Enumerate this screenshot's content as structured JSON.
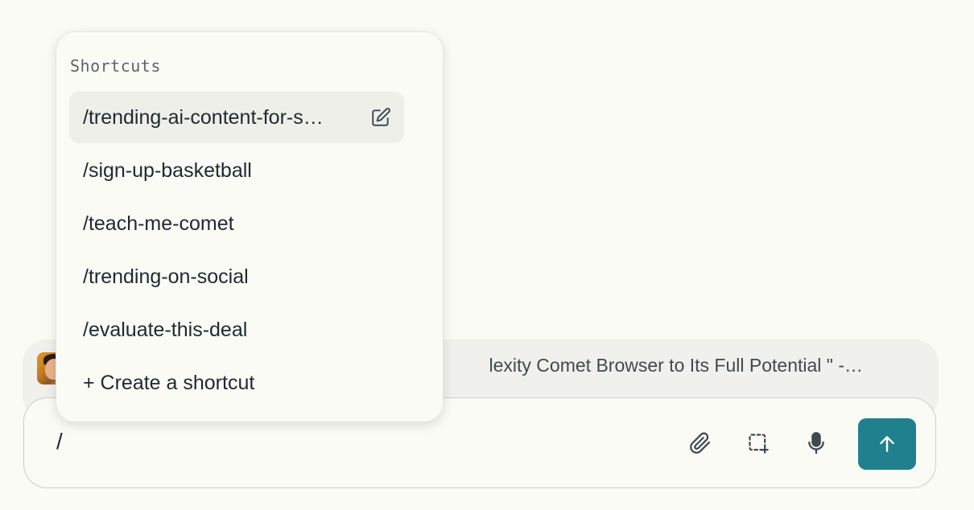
{
  "context": {
    "text": "lexity Comet Browser to Its Full Potential \" -…"
  },
  "shortcuts_menu": {
    "title": "Shortcuts",
    "items": [
      {
        "label": "/trending-ai-content-for-s…",
        "active": true
      },
      {
        "label": "/sign-up-basketball"
      },
      {
        "label": "/teach-me-comet"
      },
      {
        "label": "/trending-on-social"
      },
      {
        "label": "/evaluate-this-deal"
      }
    ],
    "create_label": "+ Create a shortcut"
  },
  "input": {
    "value": "/"
  },
  "toolbar": {
    "icons": [
      "paperclip-icon",
      "screenshot-select-icon",
      "microphone-icon",
      "arrow-up-icon"
    ]
  },
  "colors": {
    "accent": "#21808d",
    "background": "#fbfbf6"
  }
}
